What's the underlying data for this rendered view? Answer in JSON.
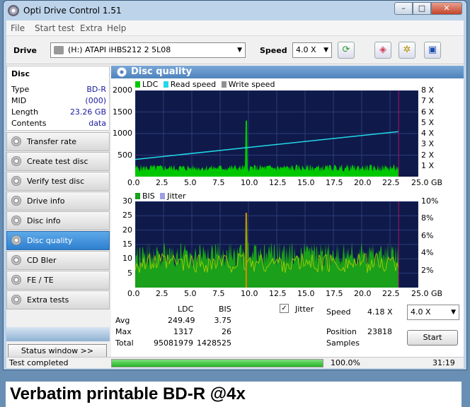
{
  "window": {
    "title": "Opti Drive Control 1.51"
  },
  "menu": [
    "File",
    "Start test",
    "Extra",
    "Help"
  ],
  "toolbar": {
    "drive_label": "Drive",
    "drive_value": "(H:)  ATAPI iHBS212  2 5L08",
    "speed_label": "Speed",
    "speed_value": "4.0 X"
  },
  "disc": {
    "header": "Disc",
    "rows": [
      {
        "k": "Type",
        "v": "BD-R"
      },
      {
        "k": "MID",
        "v": "(000)"
      },
      {
        "k": "Length",
        "v": "23.26 GB"
      },
      {
        "k": "Contents",
        "v": "data"
      }
    ]
  },
  "nav": [
    "Transfer rate",
    "Create test disc",
    "Verify test disc",
    "Drive info",
    "Disc info",
    "Disc quality",
    "CD Bler",
    "FE / TE",
    "Extra tests"
  ],
  "nav_active": "Disc quality",
  "status_window_button": "Status window >>",
  "panel": {
    "title": "Disc quality"
  },
  "chart_data": [
    {
      "type": "area",
      "legend": [
        "LDC",
        "Read speed",
        "Write speed"
      ],
      "colors": {
        "LDC": "#00c800",
        "Read speed": "#22d8e8",
        "Write speed": "#909090"
      },
      "x_ticks": [
        "0.0",
        "2.5",
        "5.0",
        "7.5",
        "10.0",
        "12.5",
        "15.0",
        "17.5",
        "20.0",
        "22.5",
        "25.0 GB"
      ],
      "xlim": [
        0,
        25
      ],
      "y_ticks_left": [
        "2000",
        "1500",
        "1000",
        "500"
      ],
      "ylim_left": [
        0,
        2000
      ],
      "y_ticks_right": [
        "8 X",
        "7 X",
        "6 X",
        "5 X",
        "4 X",
        "3 X",
        "2 X",
        "1 X"
      ],
      "ylim_right": [
        0,
        8
      ],
      "ldc_baseline": 220,
      "ldc_spike": {
        "x": 9.8,
        "y": 1300
      },
      "read_speed": {
        "x": [
          0,
          23.26
        ],
        "y": [
          1.6,
          4.18
        ]
      },
      "disc_end": 23.26
    },
    {
      "type": "area",
      "legend": [
        "BIS",
        "Jitter"
      ],
      "colors": {
        "BIS": "#1aa01a",
        "Jitter": "#9d9de0"
      },
      "x_ticks": [
        "0.0",
        "2.5",
        "5.0",
        "7.5",
        "10.0",
        "12.5",
        "15.0",
        "17.5",
        "20.0",
        "22.5",
        "25.0 GB"
      ],
      "xlim": [
        0,
        25
      ],
      "y_ticks_left": [
        "30",
        "25",
        "20",
        "15",
        "10",
        "5"
      ],
      "ylim_left": [
        0,
        30
      ],
      "y_ticks_right": [
        "10%",
        "8%",
        "6%",
        "4%",
        "2%"
      ],
      "ylim_right": [
        0,
        10
      ],
      "bis_baseline": 10,
      "bis_spike": {
        "x": 9.8,
        "y": 26
      },
      "disc_end": 23.26
    }
  ],
  "stats": {
    "col_ldc": "LDC",
    "col_bis": "BIS",
    "rows": [
      {
        "label": "Avg",
        "ldc": "249.49",
        "bis": "3.75"
      },
      {
        "label": "Max",
        "ldc": "1317",
        "bis": "26"
      },
      {
        "label": "Total",
        "ldc": "95081979",
        "bis": "1428525"
      }
    ],
    "jitter_label": "Jitter",
    "jitter_checked": "✓",
    "speed_label": "Speed",
    "speed_value": "4.18 X",
    "speed_select": "4.0 X",
    "position_label": "Position",
    "position_value": "23818",
    "samples_label": "Samples",
    "start_button": "Start"
  },
  "statusbar": {
    "text": "Test completed",
    "progress": 100,
    "progress_text": "100.0%",
    "time": "31:19"
  },
  "caption": "Verbatim printable BD-R @4x"
}
